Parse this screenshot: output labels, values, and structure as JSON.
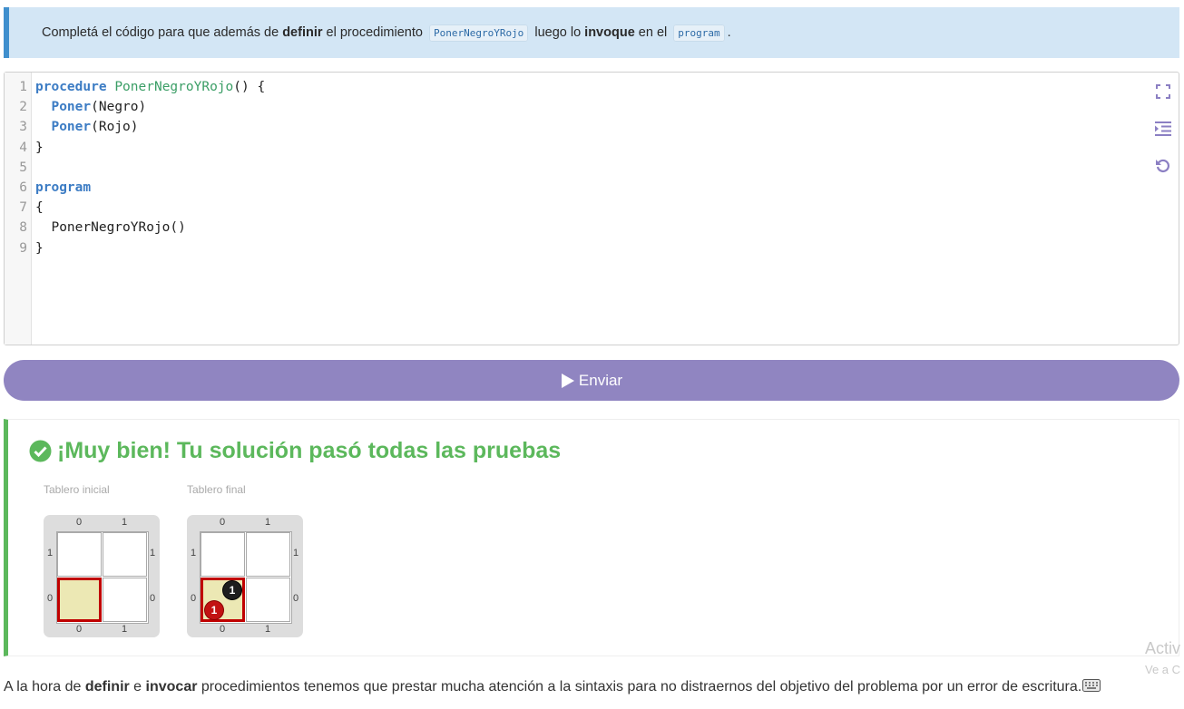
{
  "instruction": {
    "part1": "Completá el código para que además de ",
    "bold1": "definir",
    "part2": " el procedimiento ",
    "code1": "PonerNegroYRojo",
    "part3": " luego lo ",
    "bold2": "invoque",
    "part4": " en el ",
    "code2": "program",
    "part5": "."
  },
  "editor": {
    "line_numbers": [
      "1",
      "2",
      "3",
      "4",
      "5",
      "6",
      "7",
      "8",
      "9"
    ],
    "lines": [
      [
        {
          "t": "procedure",
          "c": "kw"
        },
        {
          "t": " ",
          "c": ""
        },
        {
          "t": "PonerNegroYRojo",
          "c": "fn"
        },
        {
          "t": "() {",
          "c": ""
        }
      ],
      [
        {
          "t": "  ",
          "c": ""
        },
        {
          "t": "Poner",
          "c": "call"
        },
        {
          "t": "(Negro)",
          "c": ""
        }
      ],
      [
        {
          "t": "  ",
          "c": ""
        },
        {
          "t": "Poner",
          "c": "call"
        },
        {
          "t": "(Rojo)",
          "c": ""
        }
      ],
      [
        {
          "t": "}",
          "c": ""
        }
      ],
      [
        {
          "t": "",
          "c": ""
        }
      ],
      [
        {
          "t": "program",
          "c": "kw"
        }
      ],
      [
        {
          "t": "{",
          "c": ""
        }
      ],
      [
        {
          "t": "  PonerNegroYRojo()",
          "c": ""
        }
      ],
      [
        {
          "t": "}",
          "c": ""
        }
      ]
    ],
    "tool_icons": [
      "fullscreen-icon",
      "indent-icon",
      "reset-icon"
    ]
  },
  "submit": {
    "label": "Enviar",
    "icon": "play-icon"
  },
  "result": {
    "title": "¡Muy bien! Tu solución pasó todas las pruebas",
    "icon": "check-circle-icon",
    "boards": [
      {
        "label": "Tablero inicial",
        "cols": [
          "0",
          "1"
        ],
        "rows": [
          "1",
          "0"
        ],
        "selected": [
          0,
          0
        ],
        "balls": []
      },
      {
        "label": "Tablero final",
        "cols": [
          "0",
          "1"
        ],
        "rows": [
          "1",
          "0"
        ],
        "selected": [
          0,
          0
        ],
        "balls": [
          {
            "color": "black",
            "count": "1"
          },
          {
            "color": "red",
            "count": "1"
          }
        ]
      }
    ]
  },
  "footer": {
    "part1": "A la hora de ",
    "bold1": "definir",
    "part2": " e ",
    "bold2": "invocar",
    "part3": " procedimientos tenemos que prestar mucha atención a la sintaxis para no distraernos del objetivo del problema por un error de escritura.",
    "icon": "keyboard-icon"
  },
  "watermark": {
    "line1": "Activ",
    "line2": "Ve a C"
  },
  "colors": {
    "accent": "#9085c1",
    "success": "#5cb85c",
    "info_border": "#3f8fcd",
    "selection": "#c00000"
  }
}
